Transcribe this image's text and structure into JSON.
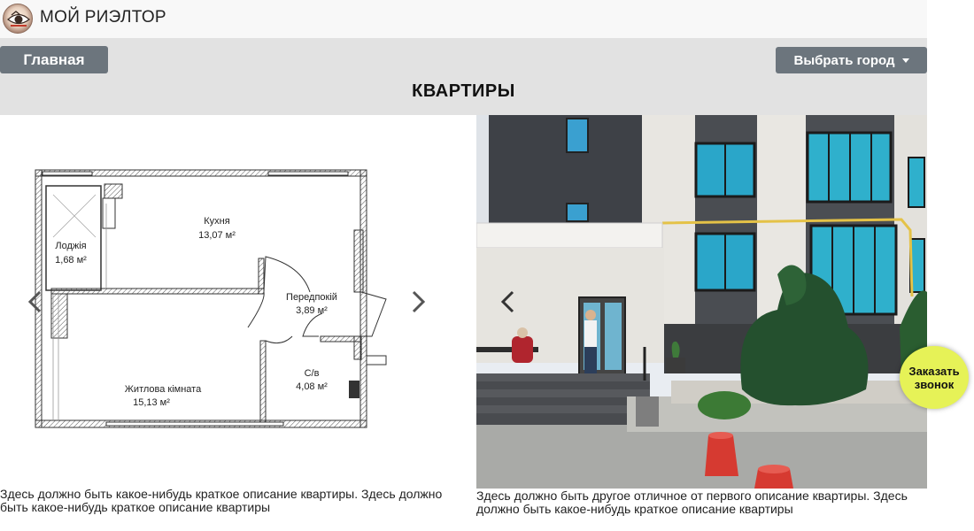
{
  "header": {
    "brand": "МОЙ РИЭЛТОР",
    "logo_icon": "realtor-logo-icon"
  },
  "nav": {
    "home_label": "Главная",
    "city_label": "Выбрать город"
  },
  "page": {
    "title": "КВАРТИРЫ"
  },
  "listings": [
    {
      "image": "floor-plan",
      "rooms": [
        {
          "name": "Кухня",
          "area": "13,07 м²"
        },
        {
          "name": "Лоджія",
          "area": "1,68 м²"
        },
        {
          "name": "Передпокій",
          "area": "3,89 м²"
        },
        {
          "name": "Житлова кімната",
          "area": "15,13 м²"
        },
        {
          "name": "С/в",
          "area": "4,08 м²"
        }
      ],
      "description": "Здесь должно быть какое-нибудь краткое описание квартиры. Здесь должно быть какое-нибудь краткое описание квартиры"
    },
    {
      "image": "building-entrance-photo",
      "description": "Здесь должно быть другое отличное от первого описание квартиры. Здесь должно быть какое-нибудь краткое описание квартиры"
    }
  ],
  "call_button": {
    "line1": "Заказать",
    "line2": "звонок",
    "color": "#e6f257"
  },
  "colors": {
    "button_gray": "#6c757d",
    "hero_bg": "#e2e2e2",
    "topbar_bg": "#f8f8f8"
  }
}
